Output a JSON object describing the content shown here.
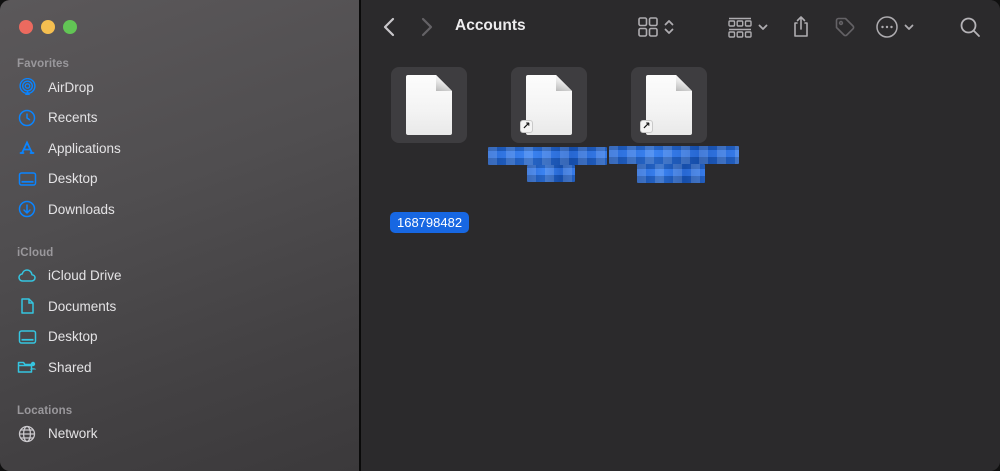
{
  "window": {
    "title": "Accounts"
  },
  "traffic_lights": {
    "close": "#ec6a5f",
    "minimize": "#f5bf50",
    "zoom": "#62c555"
  },
  "sidebar": {
    "sections": [
      {
        "label": "Favorites",
        "items": [
          {
            "label": "AirDrop",
            "icon": "airdrop-icon"
          },
          {
            "label": "Recents",
            "icon": "clock-icon"
          },
          {
            "label": "Applications",
            "icon": "applications-icon"
          },
          {
            "label": "Desktop",
            "icon": "desktop-icon"
          },
          {
            "label": "Downloads",
            "icon": "downloads-icon"
          }
        ]
      },
      {
        "label": "iCloud",
        "items": [
          {
            "label": "iCloud Drive",
            "icon": "cloud-icon"
          },
          {
            "label": "Documents",
            "icon": "document-icon"
          },
          {
            "label": "Desktop",
            "icon": "desktop-icon"
          },
          {
            "label": "Shared",
            "icon": "shared-folder-icon"
          }
        ]
      },
      {
        "label": "Locations",
        "items": [
          {
            "label": "Network",
            "icon": "globe-icon"
          }
        ]
      }
    ]
  },
  "toolbar": {
    "title": "Accounts",
    "buttons": [
      "back",
      "forward",
      "view-grid",
      "group",
      "share",
      "tag",
      "more-options",
      "search"
    ]
  },
  "files": {
    "items": [
      {
        "label": "168798482",
        "selected": true,
        "alias": false,
        "redacted": false
      },
      {
        "label": "",
        "selected": true,
        "alias": true,
        "redacted": true
      },
      {
        "label": "",
        "selected": true,
        "alias": true,
        "redacted": true
      }
    ]
  },
  "colors": {
    "accent_blue": "#0a84ff",
    "selection_label_blue": "#1767e2",
    "icloud_cyan": "#35c5e0",
    "sidebar_text": "#e4e3e5",
    "section_header": "#9a989c",
    "main_bg": "#2b2a2c",
    "tile_bg": "#3e3d40"
  }
}
